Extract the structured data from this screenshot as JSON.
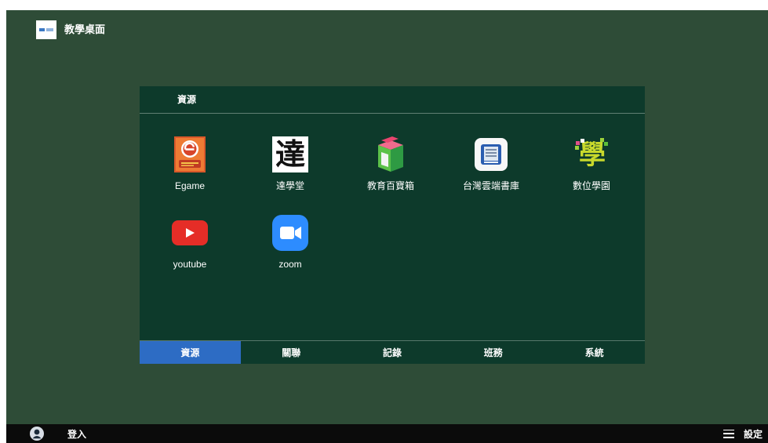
{
  "app": {
    "title": "教學桌面",
    "logo_icon": "app-logo-icon"
  },
  "colors": {
    "desktop_background": "#2e4c37",
    "panel_background": "#0d3a2b",
    "selected_tab": "#2d6cc4",
    "bottom_bar": "#0b0b0b"
  },
  "panel": {
    "header": "資源",
    "apps": [
      {
        "label": "Egame",
        "icon": "egame-icon"
      },
      {
        "label": "達學堂",
        "icon": "da-xue-tang-icon",
        "glyph": "達"
      },
      {
        "label": "教育百寶箱",
        "icon": "treasure-box-icon"
      },
      {
        "label": "台灣雲端書庫",
        "icon": "cloud-library-icon"
      },
      {
        "label": "數位學園",
        "icon": "digital-school-icon",
        "glyph": "學"
      },
      {
        "label": "youtube",
        "icon": "youtube-icon"
      },
      {
        "label": "zoom",
        "icon": "zoom-icon"
      }
    ],
    "tabs": [
      {
        "label": "資源",
        "selected": true
      },
      {
        "label": "關聯",
        "selected": false
      },
      {
        "label": "記錄",
        "selected": false
      },
      {
        "label": "班務",
        "selected": false
      },
      {
        "label": "系統",
        "selected": false
      }
    ]
  },
  "bottom_bar": {
    "avatar_icon": "avatar-icon",
    "login_label": "登入",
    "menu_icon": "menu-icon",
    "settings_label": "設定"
  }
}
